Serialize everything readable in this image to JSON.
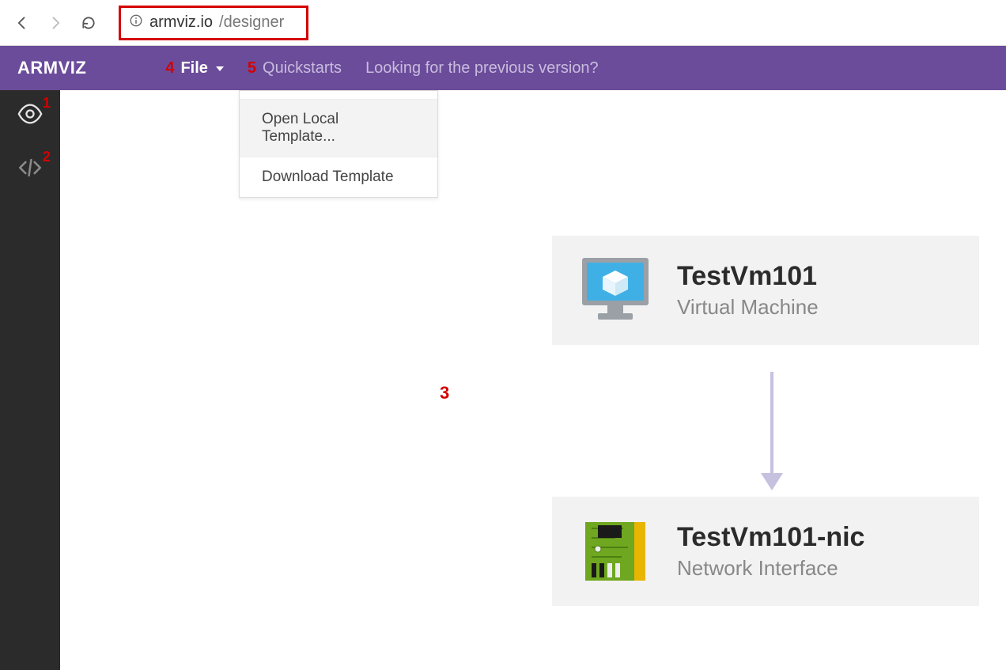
{
  "browser": {
    "url_host": "armviz.io",
    "url_path": "/designer"
  },
  "header": {
    "brand": "ARMVIZ",
    "file_label": "File",
    "quickstarts_label": "Quickstarts",
    "previous_link": "Looking for the previous version?"
  },
  "annotations": {
    "a1": "1",
    "a2": "2",
    "a3": "3",
    "a4": "4",
    "a5": "5"
  },
  "dropdown": {
    "open_local": "Open Local Template...",
    "download": "Download Template"
  },
  "resources": [
    {
      "name": "TestVm101",
      "type": "Virtual Machine"
    },
    {
      "name": "TestVm101-nic",
      "type": "Network Interface"
    }
  ]
}
